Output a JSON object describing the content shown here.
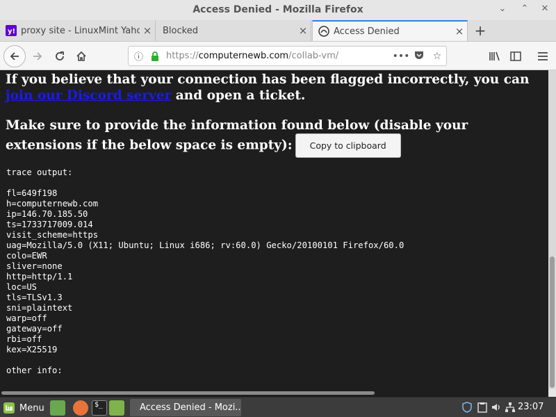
{
  "window": {
    "title": "Access Denied - Mozilla Firefox"
  },
  "tabs": [
    {
      "label": "proxy site - LinuxMint Yahoo Search",
      "favicon": "yahoo-icon",
      "active": false
    },
    {
      "label": "Blocked",
      "favicon": "",
      "active": false
    },
    {
      "label": "Access Denied",
      "favicon": "cloudflare-icon",
      "active": true
    }
  ],
  "url": {
    "prefix": "https://",
    "host": "computernewb.com",
    "path": "/collab-vm/"
  },
  "page": {
    "para1_text": "If you believe that your connection has been flagged incorrectly, you can",
    "link_text": "join our Discord server",
    "para1_tail": " and open a ticket.",
    "para2_text": "Make sure to provide the information found below (disable your extensions if the below space is empty):",
    "copy_button": "Copy to clipboard",
    "trace": "trace output:\n\nfl=649f198\nh=computernewb.com\nip=146.70.185.50\nts=1733717009.014\nvisit_scheme=https\nuag=Mozilla/5.0 (X11; Ubuntu; Linux i686; rv:60.0) Gecko/20100101 Firefox/60.0\ncolo=EWR\nsliver=none\nhttp=http/1.1\nloc=US\ntls=TLSv1.3\nsni=plaintext\nwarp=off\ngateway=off\nrbi=off\nkex=X25519\n\nother info:"
  },
  "taskbar": {
    "menu_label": "Menu",
    "window_label": "Access Denied - Mozi...",
    "clock": "23:07"
  },
  "colors": {
    "page_bg": "#1e1e1e",
    "link": "#1a1aee",
    "accent": "#2d7fe6",
    "lock_green": "#2eae2e",
    "taskbar_bg": "#3c3c3c"
  }
}
